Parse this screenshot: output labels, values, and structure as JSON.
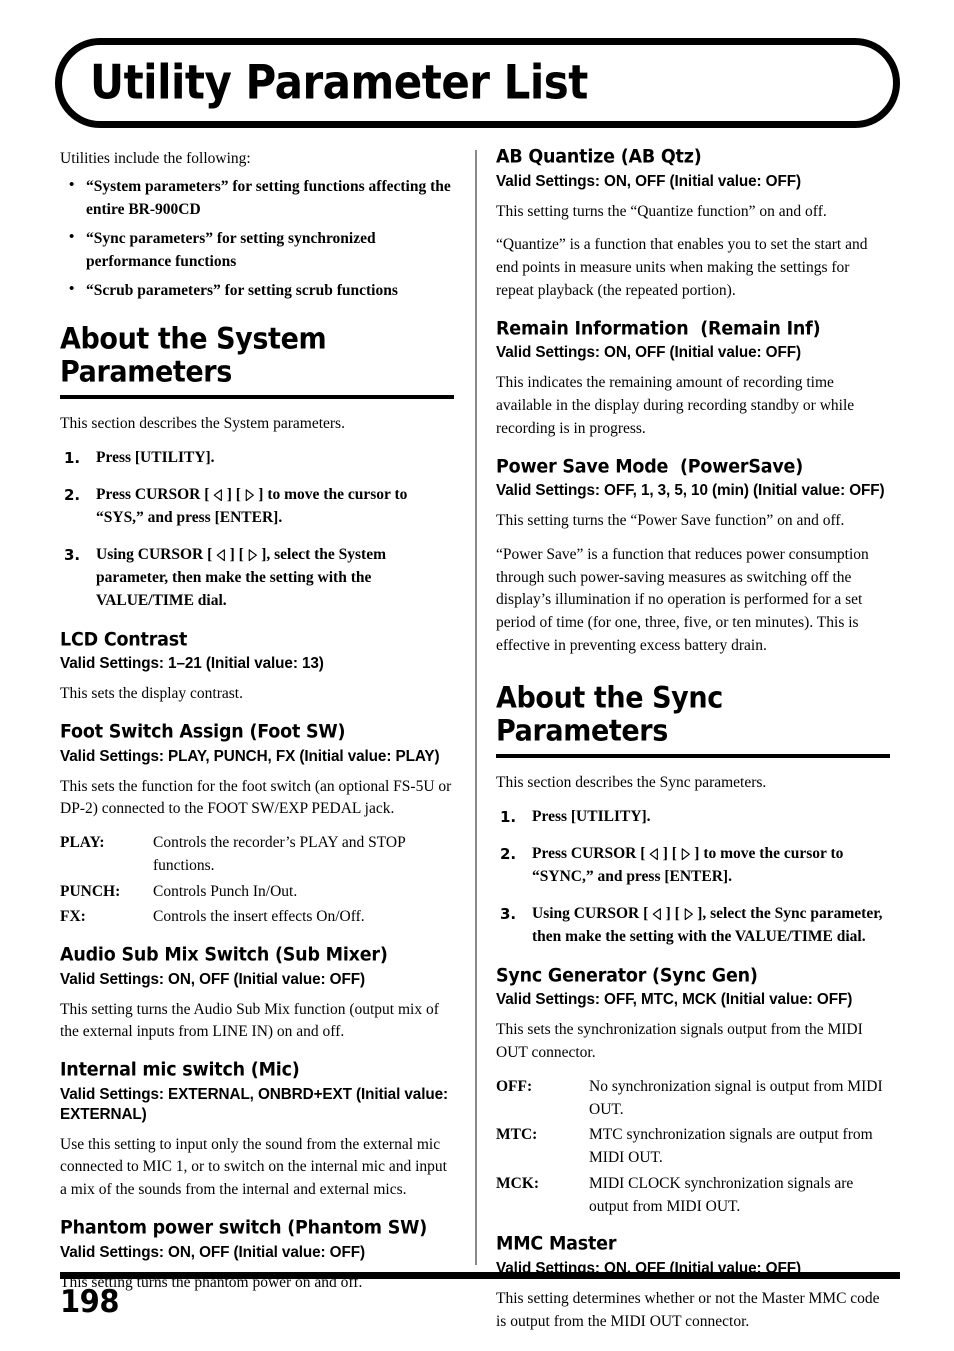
{
  "page": {
    "title": "Utility Parameter List",
    "number": "198"
  },
  "intro": {
    "lead": "Utilities include the following:",
    "bullets": [
      "“System parameters” for setting functions affecting the entire BR-900CD",
      "“Sync parameters” for setting synchronized performance functions",
      "“Scrub parameters” for setting scrub functions"
    ]
  },
  "system_section": {
    "heading": "About the System Parameters",
    "lead": "This section describes the System parameters.",
    "steps": [
      {
        "num": "1.",
        "pre": "Press [UTILITY].",
        "has_arrows": false,
        "post": ""
      },
      {
        "num": "2.",
        "pre": "Press CURSOR [ ",
        "has_arrows": true,
        "post": " ] to move the cursor to “SYS,” and press [ENTER]."
      },
      {
        "num": "3.",
        "pre": "Using CURSOR [ ",
        "has_arrows": true,
        "post": " ], select the System parameter, then make the setting with the VALUE/TIME dial."
      }
    ],
    "params": [
      {
        "name": "LCD Contrast",
        "valid": "Valid Settings: 1–21 (Initial value: 13)",
        "paragraphs": [
          "This sets the display contrast."
        ],
        "deflist": []
      },
      {
        "name": "Foot Switch Assign (Foot SW)",
        "valid": "Valid Settings: PLAY, PUNCH, FX (Initial value: PLAY)",
        "paragraphs": [
          "This sets the function for the foot switch (an optional FS-5U or DP-2) connected to the FOOT SW/EXP PEDAL jack."
        ],
        "deflist": [
          {
            "term": "PLAY:",
            "desc": "Controls the recorder’s PLAY and STOP functions."
          },
          {
            "term": "PUNCH:",
            "desc": "Controls Punch In/Out."
          },
          {
            "term": "FX:",
            "desc": "Controls the insert effects On/Off."
          }
        ]
      },
      {
        "name": "Audio Sub Mix Switch (Sub Mixer)",
        "valid": "Valid Settings: ON, OFF (Initial value: OFF)",
        "paragraphs": [
          "This setting turns the Audio Sub Mix function (output mix of the external inputs from LINE IN) on and off."
        ],
        "deflist": []
      },
      {
        "name": "Internal mic switch (Mic)",
        "valid": "Valid Settings: EXTERNAL, ONBRD+EXT\n(Initial value: EXTERNAL)",
        "paragraphs": [
          "Use this setting to input only the sound from the external mic connected to MIC 1, or to switch on the internal mic and input a mix of the sounds from the internal and external mics."
        ],
        "deflist": []
      },
      {
        "name": "Phantom power switch (Phantom SW)",
        "valid": "Valid Settings: ON, OFF (Initial value: OFF)",
        "paragraphs": [
          "This setting turns the phantom power on and off."
        ],
        "deflist": []
      }
    ]
  },
  "right_params_top": [
    {
      "name": "AB Quantize (AB Qtz)",
      "valid": "Valid Settings: ON, OFF (Initial value: OFF)",
      "paragraphs": [
        "This setting turns the “Quantize function” on and off.",
        "“Quantize” is a function that enables you to set the start and end points in measure units when making the settings for repeat playback (the repeated portion)."
      ]
    },
    {
      "name": "Remain Information  (Remain Inf)",
      "valid": "Valid Settings: ON, OFF (Initial value: OFF)",
      "paragraphs": [
        "This indicates the remaining amount of recording time available in the display during recording standby or while recording is in progress."
      ]
    },
    {
      "name": "Power Save Mode  (PowerSave)",
      "valid": "Valid Settings: OFF, 1, 3, 5, 10 (min) (Initial value: OFF)",
      "paragraphs": [
        "This setting turns the “Power Save function” on and off.",
        "“Power Save” is a function that reduces power consumption through such power-saving measures as switching off the display’s illumination if no operation is performed for a set period of time (for one, three, five, or ten minutes). This is effective in preventing excess battery drain."
      ]
    }
  ],
  "sync_section": {
    "heading": "About the Sync Parameters",
    "lead": "This section describes the Sync parameters.",
    "steps": [
      {
        "num": "1.",
        "pre": "Press [UTILITY].",
        "has_arrows": false,
        "post": ""
      },
      {
        "num": "2.",
        "pre": "Press CURSOR [ ",
        "has_arrows": true,
        "post": " ] to move the cursor to “SYNC,” and press [ENTER]."
      },
      {
        "num": "3.",
        "pre": "Using CURSOR [ ",
        "has_arrows": true,
        "post": " ], select the Sync parameter, then make the setting with the VALUE/TIME dial."
      }
    ],
    "params": [
      {
        "name": "Sync Generator (Sync Gen)",
        "valid": "Valid Settings: OFF, MTC, MCK (Initial value: OFF)",
        "paragraphs": [
          "This sets the synchronization signals output from the MIDI OUT connector."
        ],
        "deflist": [
          {
            "term": "OFF:",
            "desc": "No synchronization signal is output from MIDI OUT."
          },
          {
            "term": "MTC:",
            "desc": "MTC synchronization signals are output from MIDI OUT."
          },
          {
            "term": "MCK:",
            "desc": "MIDI CLOCK synchronization signals are output from MIDI OUT."
          }
        ]
      },
      {
        "name": "MMC Master",
        "valid": "Valid Settings: ON, OFF (Initial value: OFF)",
        "paragraphs": [
          "This setting determines whether or not the Master MMC code is output from the MIDI OUT connector."
        ],
        "deflist": []
      }
    ]
  },
  "icons": {
    "cursor_left": "triangle-left-outline-icon",
    "cursor_right": "triangle-right-outline-icon",
    "bullet": "bullet-dot-icon"
  },
  "colors": {
    "text": "#000000",
    "page_background": "#ffffff",
    "column_divider": "#8a8a8a",
    "rule": "#000000"
  }
}
